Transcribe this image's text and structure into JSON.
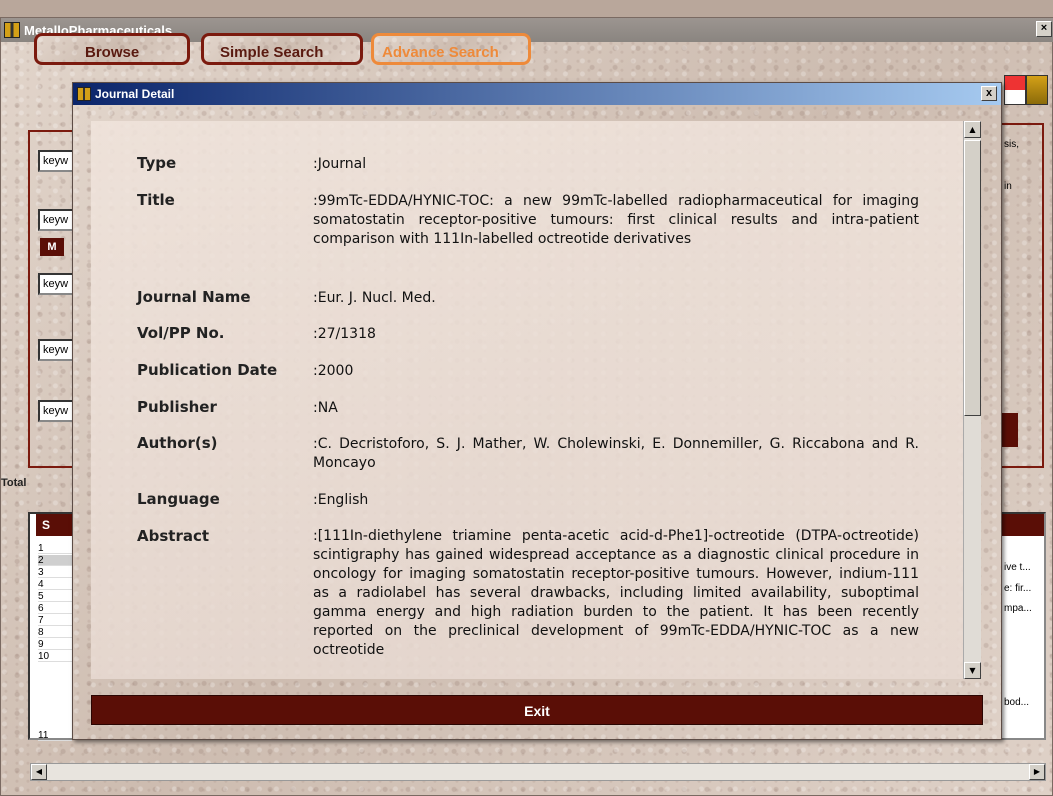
{
  "main_window": {
    "title": "MetalloPharmaceuticals",
    "tabs": [
      {
        "label": "Browse"
      },
      {
        "label": "Simple Search"
      },
      {
        "label": "Advance Search"
      }
    ],
    "keyword_fields": [
      "keyw",
      "keyw",
      "keyw",
      "keyw",
      "keyw"
    ],
    "m_button": "M",
    "total_label": "Total",
    "right_snippets": [
      "sis,",
      "in"
    ],
    "grid": {
      "header_label": "S",
      "row_numbers": [
        "1",
        "2",
        "3",
        "4",
        "5",
        "6",
        "7",
        "8",
        "9",
        "10",
        "11"
      ],
      "selected_row": "2",
      "right_snippets": [
        "ive t...",
        "e: fir...",
        "mpa...",
        "bod..."
      ]
    }
  },
  "dialog": {
    "title": "Journal Detail",
    "close_label": "x",
    "fields": {
      "type": {
        "label": "Type",
        "value": ":Journal"
      },
      "title": {
        "label": "Title",
        "value": ":99mTc-EDDA/HYNIC-TOC: a new 99mTc-labelled radiopharmaceutical for imaging somatostatin receptor-positive tumours: first clinical results and intra-patient comparison with 111In-labelled octreotide derivatives"
      },
      "journal_name": {
        "label": "Journal Name",
        "value": ":Eur. J. Nucl. Med."
      },
      "vol_pp": {
        "label": "Vol/PP No.",
        "value": ":27/1318"
      },
      "publication_date": {
        "label": "Publication Date",
        "value": ":2000"
      },
      "publisher": {
        "label": "Publisher",
        "value": ":NA"
      },
      "authors": {
        "label": "Author(s)",
        "value": ":C. Decristoforo, S. J. Mather, W. Cholewinski, E. Donnemiller, G. Riccabona and R. Moncayo"
      },
      "language": {
        "label": "Language",
        "value": ":English"
      },
      "abstract": {
        "label": "Abstract",
        "value": ":[111In-diethylene triamine penta-acetic acid-d-Phe1]-octreotide (DTPA-octreotide) scintigraphy has gained widespread acceptance as a diagnostic clinical procedure in oncology for imaging somatostatin receptor-positive tumours. However, indium-111 as a radiolabel has several drawbacks, including limited availability, suboptimal gamma energy and high radiation burden to the patient. It has been recently reported on the preclinical development of 99mTc-EDDA/HYNIC-TOC as a new octreotide"
      }
    },
    "exit_label": "Exit"
  },
  "colors": {
    "accent_dark": "#5a0e06",
    "active_tab": "#ee8a3a",
    "dialog_title_start": "#0a246a"
  }
}
